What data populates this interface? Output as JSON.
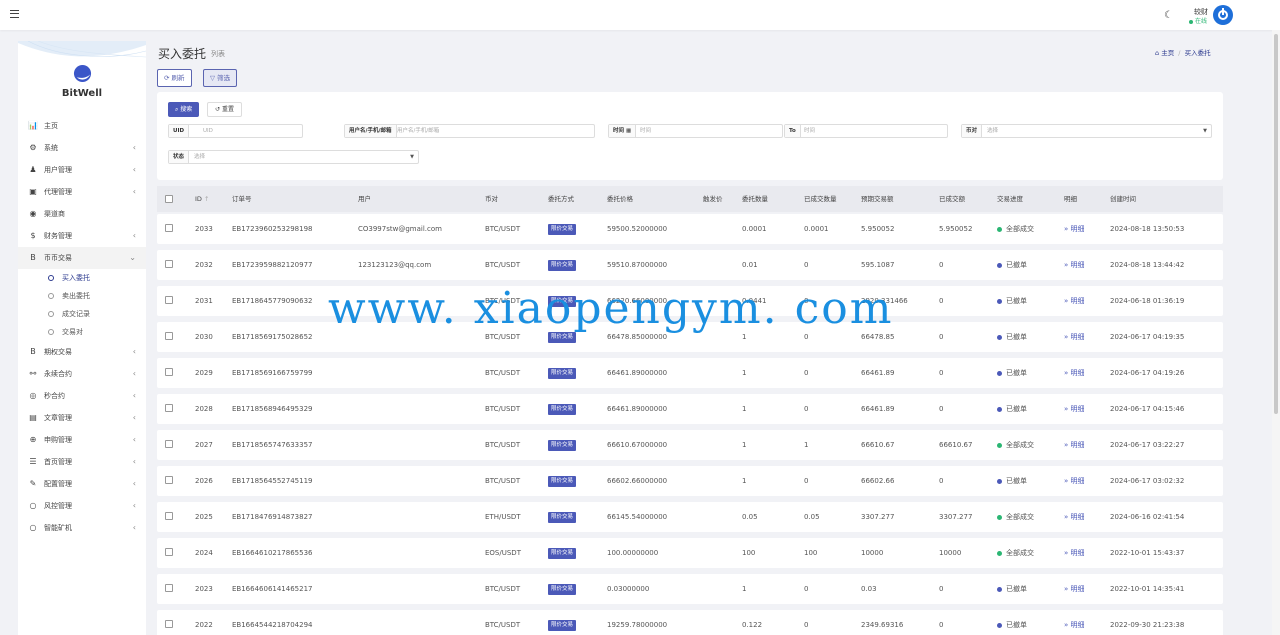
{
  "header": {
    "user_name": "较财",
    "user_status": "在线"
  },
  "sidebar": {
    "logo_text": "BitWell",
    "items": [
      {
        "label": "主页",
        "icon": "bar-chart-icon",
        "glyph": "📊",
        "arrow": ""
      },
      {
        "label": "系统",
        "icon": "gear-icon",
        "glyph": "⚙",
        "arrow": "‹"
      },
      {
        "label": "用户管理",
        "icon": "users-icon",
        "glyph": "♟",
        "arrow": "‹"
      },
      {
        "label": "代理管理",
        "icon": "id-card-icon",
        "glyph": "▣",
        "arrow": "‹"
      },
      {
        "label": "渠道商",
        "icon": "user-circle-icon",
        "glyph": "◉",
        "arrow": ""
      },
      {
        "label": "财务管理",
        "icon": "dollar-icon",
        "glyph": "$",
        "arrow": "‹"
      },
      {
        "label": "币币交易",
        "icon": "bitcoin-icon",
        "glyph": "B",
        "arrow": "⌄"
      }
    ],
    "subitems": [
      {
        "label": "买入委托"
      },
      {
        "label": "卖出委托"
      },
      {
        "label": "成交记录"
      },
      {
        "label": "交易对"
      }
    ],
    "items_after": [
      {
        "label": "期权交易",
        "icon": "bitcoin-icon",
        "glyph": "B",
        "arrow": "‹"
      },
      {
        "label": "永续合约",
        "icon": "link-icon",
        "glyph": "⚯",
        "arrow": "‹"
      },
      {
        "label": "秒合约",
        "icon": "clock-icon",
        "glyph": "◎",
        "arrow": "‹"
      },
      {
        "label": "文章管理",
        "icon": "newspaper-icon",
        "glyph": "▤",
        "arrow": "‹"
      },
      {
        "label": "申购管理",
        "icon": "globe-icon",
        "glyph": "⊕",
        "arrow": "‹"
      },
      {
        "label": "首页管理",
        "icon": "list-icon",
        "glyph": "☰",
        "arrow": "‹"
      },
      {
        "label": "配置管理",
        "icon": "wrench-icon",
        "glyph": "✎",
        "arrow": "‹"
      },
      {
        "label": "风控管理",
        "icon": "circle-icon",
        "glyph": "○",
        "arrow": "‹"
      },
      {
        "label": "智能矿机",
        "icon": "circle-icon",
        "glyph": "○",
        "arrow": "‹"
      }
    ]
  },
  "page": {
    "title": "买入委托",
    "subtitle": "列表",
    "breadcrumb_home": "主页",
    "breadcrumb_current": "买入委托",
    "refresh_label": "刷新",
    "filter_label": "筛选"
  },
  "search": {
    "search_label": "搜索",
    "reset_label": "重置",
    "uid_label": "UID",
    "uid_placeholder": "UID",
    "user_label": "用户名/手机/邮箱",
    "user_placeholder": "用户名/手机/邮箱",
    "time_label": "时间",
    "time_from_placeholder": "时间",
    "time_to_label": "To",
    "time_to_placeholder": "时间",
    "pair_label": "币对",
    "pair_value": "选择",
    "status_label": "状态",
    "status_value": "选择"
  },
  "table": {
    "columns": [
      "ID",
      "订单号",
      "用户",
      "币对",
      "委托方式",
      "委托价格",
      "触发价",
      "委托数量",
      "已成交数量",
      "预期交易额",
      "已成交额",
      "交易进度",
      "明细",
      "创建时间"
    ],
    "rows": [
      {
        "id": "2033",
        "order": "EB1723960253298198",
        "user": "CO3997stw@gmail.com",
        "pair": "BTC/USDT",
        "mode": "限价交易",
        "price": "59500.52000000",
        "trigger": "",
        "qty": "0.0001",
        "filled": "0.0001",
        "expected": "5.950052",
        "filled_amt": "5.950052",
        "progress": "全部成交",
        "progress_color": "#2bb673",
        "detail": "明细",
        "created": "2024-08-18 13:50:53"
      },
      {
        "id": "2032",
        "order": "EB1723959882120977",
        "user": "123123123@qq.com",
        "pair": "BTC/USDT",
        "mode": "限价交易",
        "price": "59510.87000000",
        "trigger": "",
        "qty": "0.01",
        "filled": "0",
        "expected": "595.1087",
        "filled_amt": "0",
        "progress": "已撤单",
        "progress_color": "#4b59b8",
        "detail": "明细",
        "created": "2024-08-18 13:44:42"
      },
      {
        "id": "2031",
        "order": "EB1718645779090632",
        "user": "",
        "pair": "BTC/USDT",
        "mode": "限价交易",
        "price": "66220.66000000",
        "trigger": "",
        "qty": "0.0441",
        "filled": "0",
        "expected": "2920.331466",
        "filled_amt": "0",
        "progress": "已撤单",
        "progress_color": "#4b59b8",
        "detail": "明细",
        "created": "2024-06-18 01:36:19"
      },
      {
        "id": "2030",
        "order": "EB1718569175028652",
        "user": "",
        "pair": "BTC/USDT",
        "mode": "限价交易",
        "price": "66478.85000000",
        "trigger": "",
        "qty": "1",
        "filled": "0",
        "expected": "66478.85",
        "filled_amt": "0",
        "progress": "已撤单",
        "progress_color": "#4b59b8",
        "detail": "明细",
        "created": "2024-06-17 04:19:35"
      },
      {
        "id": "2029",
        "order": "EB1718569166759799",
        "user": "",
        "pair": "BTC/USDT",
        "mode": "限价交易",
        "price": "66461.89000000",
        "trigger": "",
        "qty": "1",
        "filled": "0",
        "expected": "66461.89",
        "filled_amt": "0",
        "progress": "已撤单",
        "progress_color": "#4b59b8",
        "detail": "明细",
        "created": "2024-06-17 04:19:26"
      },
      {
        "id": "2028",
        "order": "EB1718568946495329",
        "user": "",
        "pair": "BTC/USDT",
        "mode": "限价交易",
        "price": "66461.89000000",
        "trigger": "",
        "qty": "1",
        "filled": "0",
        "expected": "66461.89",
        "filled_amt": "0",
        "progress": "已撤单",
        "progress_color": "#4b59b8",
        "detail": "明细",
        "created": "2024-06-17 04:15:46"
      },
      {
        "id": "2027",
        "order": "EB1718565747633357",
        "user": "",
        "pair": "BTC/USDT",
        "mode": "限价交易",
        "price": "66610.67000000",
        "trigger": "",
        "qty": "1",
        "filled": "1",
        "expected": "66610.67",
        "filled_amt": "66610.67",
        "progress": "全部成交",
        "progress_color": "#2bb673",
        "detail": "明细",
        "created": "2024-06-17 03:22:27"
      },
      {
        "id": "2026",
        "order": "EB1718564552745119",
        "user": "",
        "pair": "BTC/USDT",
        "mode": "限价交易",
        "price": "66602.66000000",
        "trigger": "",
        "qty": "1",
        "filled": "0",
        "expected": "66602.66",
        "filled_amt": "0",
        "progress": "已撤单",
        "progress_color": "#4b59b8",
        "detail": "明细",
        "created": "2024-06-17 03:02:32"
      },
      {
        "id": "2025",
        "order": "EB1718476914873827",
        "user": "",
        "pair": "ETH/USDT",
        "mode": "限价交易",
        "price": "66145.54000000",
        "trigger": "",
        "qty": "0.05",
        "filled": "0.05",
        "expected": "3307.277",
        "filled_amt": "3307.277",
        "progress": "全部成交",
        "progress_color": "#2bb673",
        "detail": "明细",
        "created": "2024-06-16 02:41:54"
      },
      {
        "id": "2024",
        "order": "EB1664610217865536",
        "user": "",
        "pair": "EOS/USDT",
        "mode": "限价交易",
        "price": "100.00000000",
        "trigger": "",
        "qty": "100",
        "filled": "100",
        "expected": "10000",
        "filled_amt": "10000",
        "progress": "全部成交",
        "progress_color": "#2bb673",
        "detail": "明细",
        "created": "2022-10-01 15:43:37"
      },
      {
        "id": "2023",
        "order": "EB1664606141465217",
        "user": "",
        "pair": "BTC/USDT",
        "mode": "限价交易",
        "price": "0.03000000",
        "trigger": "",
        "qty": "1",
        "filled": "0",
        "expected": "0.03",
        "filled_amt": "0",
        "progress": "已撤单",
        "progress_color": "#4b59b8",
        "detail": "明细",
        "created": "2022-10-01 14:35:41"
      },
      {
        "id": "2022",
        "order": "EB1664544218704294",
        "user": "",
        "pair": "BTC/USDT",
        "mode": "限价交易",
        "price": "19259.78000000",
        "trigger": "",
        "qty": "0.122",
        "filled": "0",
        "expected": "2349.69316",
        "filled_amt": "0",
        "progress": "已撤单",
        "progress_color": "#4b59b8",
        "detail": "明细",
        "created": "2022-09-30 21:23:38"
      }
    ]
  },
  "watermark": "www. xiaopengym. com",
  "colors": {
    "primary": "#4b59b8",
    "success": "#2bb673",
    "brand_blue": "#1e6fd9",
    "watermark": "#1a8fe0"
  }
}
